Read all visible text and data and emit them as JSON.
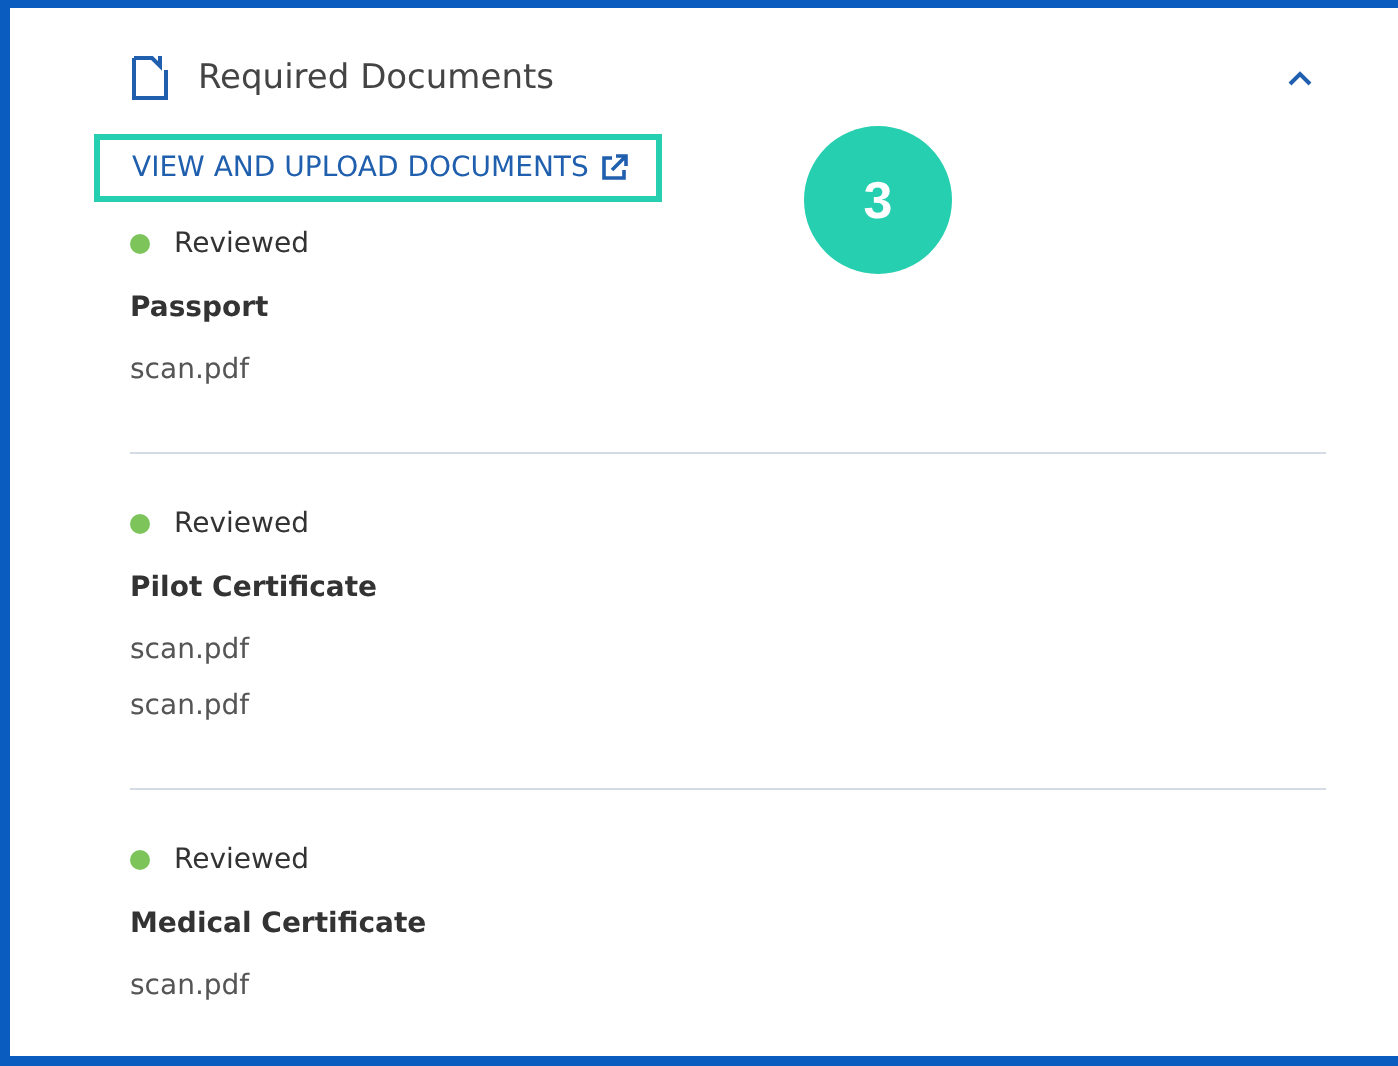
{
  "section": {
    "title": "Required Documents",
    "expanded": true
  },
  "link": {
    "label": "VIEW AND UPLOAD DOCUMENTS",
    "highlighted": true
  },
  "step_badge": "3",
  "documents": [
    {
      "status": "Reviewed",
      "color": "#7dc55a",
      "name": "Passport",
      "files": [
        "scan.pdf"
      ]
    },
    {
      "status": "Reviewed",
      "color": "#7dc55a",
      "name": "Pilot Certificate",
      "files": [
        "scan.pdf",
        "scan.pdf"
      ]
    },
    {
      "status": "Reviewed",
      "color": "#7dc55a",
      "name": "Medical Certificate",
      "files": [
        "scan.pdf"
      ]
    }
  ]
}
